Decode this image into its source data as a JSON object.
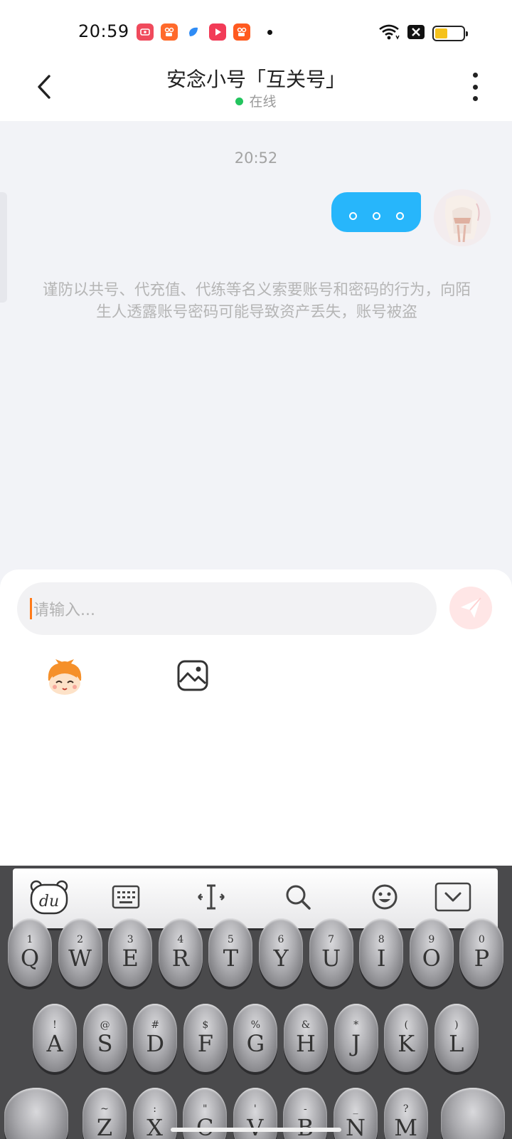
{
  "status_bar": {
    "time": "20:59"
  },
  "header": {
    "title": "安念小号「互关号」",
    "status": "在线"
  },
  "chat": {
    "timestamp": "20:52",
    "notice": "谨防以共号、代充值、代练等名义索要账号和密码的行为，向陌生人透露账号密码可能导致资产丢失，账号被盗"
  },
  "composer": {
    "placeholder": "请输入..."
  },
  "keyboard": {
    "row1": [
      {
        "sub": "1",
        "key": "Q"
      },
      {
        "sub": "2",
        "key": "W"
      },
      {
        "sub": "3",
        "key": "E"
      },
      {
        "sub": "4",
        "key": "R"
      },
      {
        "sub": "5",
        "key": "T"
      },
      {
        "sub": "6",
        "key": "Y"
      },
      {
        "sub": "7",
        "key": "U"
      },
      {
        "sub": "8",
        "key": "I"
      },
      {
        "sub": "9",
        "key": "O"
      },
      {
        "sub": "0",
        "key": "P"
      }
    ],
    "row2": [
      {
        "sub": "!",
        "key": "A"
      },
      {
        "sub": "@",
        "key": "S"
      },
      {
        "sub": "#",
        "key": "D"
      },
      {
        "sub": "$",
        "key": "F"
      },
      {
        "sub": "%",
        "key": "G"
      },
      {
        "sub": "&",
        "key": "H"
      },
      {
        "sub": "*",
        "key": "J"
      },
      {
        "sub": "(",
        "key": "K"
      },
      {
        "sub": ")",
        "key": "L"
      }
    ],
    "row3": [
      {
        "sub": "~",
        "key": "Z"
      },
      {
        "sub": ":",
        "key": "X"
      },
      {
        "sub": "\"",
        "key": "C"
      },
      {
        "sub": "'",
        "key": "V"
      },
      {
        "sub": "-",
        "key": "B"
      },
      {
        "sub": "_",
        "key": "N"
      },
      {
        "sub": "?",
        "key": "M"
      }
    ]
  },
  "colors": {
    "bubble": "#27b6fb",
    "online": "#23c45e",
    "caret": "#ff7a18",
    "send": "#ffe6e6"
  }
}
